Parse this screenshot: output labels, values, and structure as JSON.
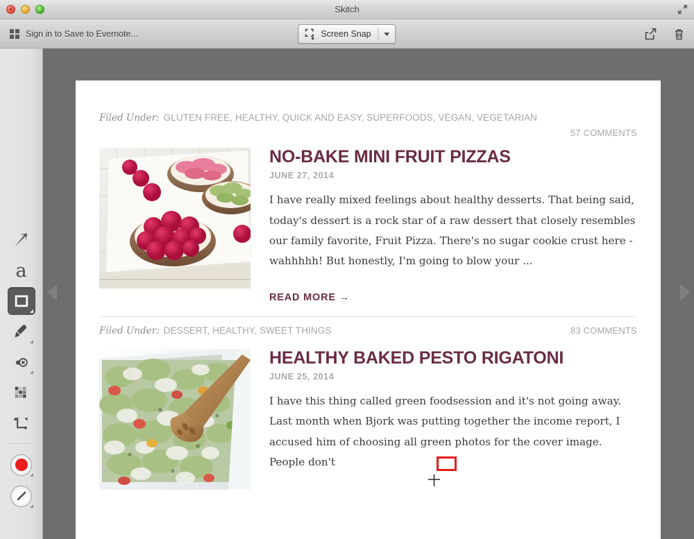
{
  "window": {
    "title": "Skitch",
    "traffic_lights": [
      "close",
      "minimize",
      "maximize"
    ]
  },
  "toolbar": {
    "evernote_signin_label": "Sign in to Save to Evernote...",
    "snap_mode_label": "Screen Snap",
    "share_icon": "share-icon",
    "trash_icon": "trash-icon",
    "fullscreen_icon": "fullscreen-icon"
  },
  "tools": [
    {
      "name": "arrow-tool",
      "icon": "arrow-icon",
      "selected": false,
      "has_options": false
    },
    {
      "name": "text-tool",
      "icon": "text-a-icon",
      "selected": false,
      "has_options": false
    },
    {
      "name": "shape-tool",
      "icon": "rectangle-icon",
      "selected": true,
      "has_options": true
    },
    {
      "name": "highlighter-tool",
      "icon": "marker-icon",
      "selected": false,
      "has_options": true
    },
    {
      "name": "blur-stamp-tool",
      "icon": "stamp-icon",
      "selected": false,
      "has_options": true
    },
    {
      "name": "pixelate-tool",
      "icon": "pixelate-icon",
      "selected": false,
      "has_options": false
    },
    {
      "name": "crop-tool",
      "icon": "crop-icon",
      "selected": false,
      "has_options": false
    }
  ],
  "color_swatch": {
    "name": "color-swatch",
    "color": "#e81d1d",
    "has_options": true
  },
  "line_style": {
    "name": "line-style-tool",
    "icon": "pen-stroke-icon",
    "has_options": true
  },
  "annotation": {
    "type": "rectangle",
    "color": "#e81d1d",
    "stroke_width": 3
  },
  "articles": [
    {
      "filed_under_label": "Filed Under:",
      "categories": "GLUTEN FREE, HEALTHY, QUICK AND EASY, SUPERFOODS, VEGAN, VEGETARIAN",
      "comments": "57 COMMENTS",
      "title": "NO-BAKE MINI FRUIT PIZZAS",
      "date": "JUNE 27, 2014",
      "excerpt": "I have really mixed feelings about healthy desserts. That being said, today's dessert is a rock star of a raw dessert that closely resembles our family favorite, Fruit Pizza. There's no sugar cookie crust here - wahhhhh! But honestly, I'm going to blow your ...",
      "read_more": "READ MORE →",
      "image_alt": "raspberry-tart-photo"
    },
    {
      "filed_under_label": "Filed Under:",
      "categories": "DESSERT, HEALTHY, SWEET THINGS",
      "comments": "83 COMMENTS",
      "title": "HEALTHY BAKED PESTO RIGATONI",
      "date": "JUNE 25, 2014",
      "excerpt": "I have this thing called green foodsession and it's not going away. Last month when Bjork was putting together the income report, I accused him of choosing all green photos for the cover image. People don't",
      "read_more": "",
      "image_alt": "pesto-pasta-photo"
    }
  ],
  "colors": {
    "title_accent": "#6a2c45",
    "annotation_red": "#e81d1d",
    "canvas_bg": "#6e6e6e",
    "meta_gray": "#a6a6a6"
  }
}
